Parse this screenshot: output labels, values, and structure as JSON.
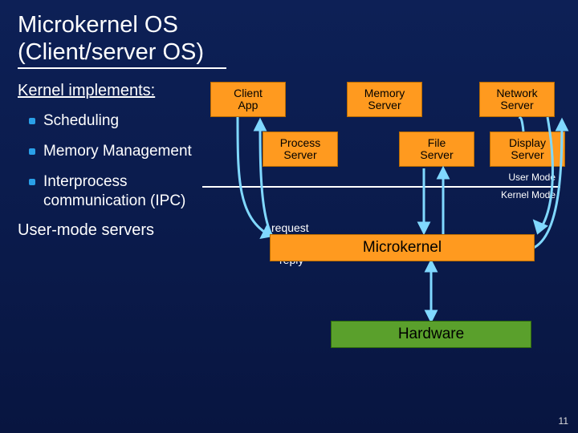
{
  "title_line1": "Microkernel OS",
  "title_line2": "(Client/server OS)",
  "left": {
    "kernel_implements": "Kernel implements:",
    "items": [
      "Scheduling",
      "Memory Management",
      "Interprocess communication (IPC)"
    ],
    "user_mode_servers": "User-mode servers"
  },
  "diagram": {
    "top_row": [
      {
        "l1": "Client",
        "l2": "App"
      },
      {
        "l1": "Memory",
        "l2": "Server"
      },
      {
        "l1": "Network",
        "l2": "Server"
      }
    ],
    "second_row": [
      {
        "l1": "Process",
        "l2": "Server"
      },
      {
        "l1": "File",
        "l2": "Server"
      },
      {
        "l1": "Display",
        "l2": "Server"
      }
    ],
    "user_mode_label": "User Mode",
    "kernel_mode_label": "Kernel Mode",
    "request_label": "request",
    "reply_label": "reply",
    "microkernel": "Microkernel",
    "hardware": "Hardware"
  },
  "slide_number": "11"
}
